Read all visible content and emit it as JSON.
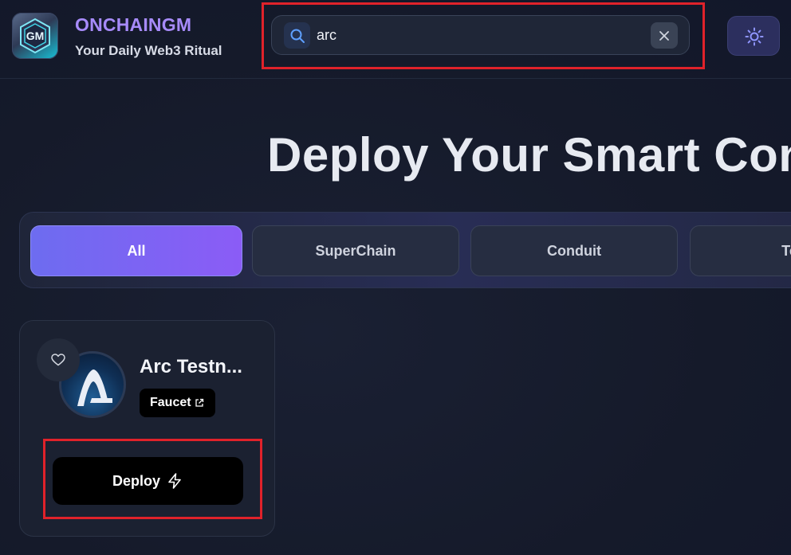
{
  "brand": {
    "title": "ONCHAINGM",
    "subtitle": "Your Daily Web3 Ritual",
    "logo_text": "GM"
  },
  "search": {
    "value": "arc",
    "icon": "search-icon",
    "clear_icon": "close-icon"
  },
  "theme_toggle": {
    "icon": "sun-icon"
  },
  "hero": {
    "title": "Deploy Your Smart Cont"
  },
  "tabs": [
    {
      "label": "All",
      "active": true
    },
    {
      "label": "SuperChain",
      "active": false
    },
    {
      "label": "Conduit",
      "active": false
    },
    {
      "label": "Tes",
      "active": false
    }
  ],
  "cards": [
    {
      "name": "Arc Testn...",
      "faucet_label": "Faucet",
      "deploy_label": "Deploy",
      "favorite_icon": "heart-icon",
      "external_icon": "external-link-icon",
      "deploy_icon": "lightning-icon"
    }
  ],
  "colors": {
    "background": "#141a2b",
    "brand_accent": "#a78bfa",
    "active_tab_start": "#6d6cf0",
    "active_tab_end": "#8b5cf6",
    "highlight": "#e0222a"
  }
}
